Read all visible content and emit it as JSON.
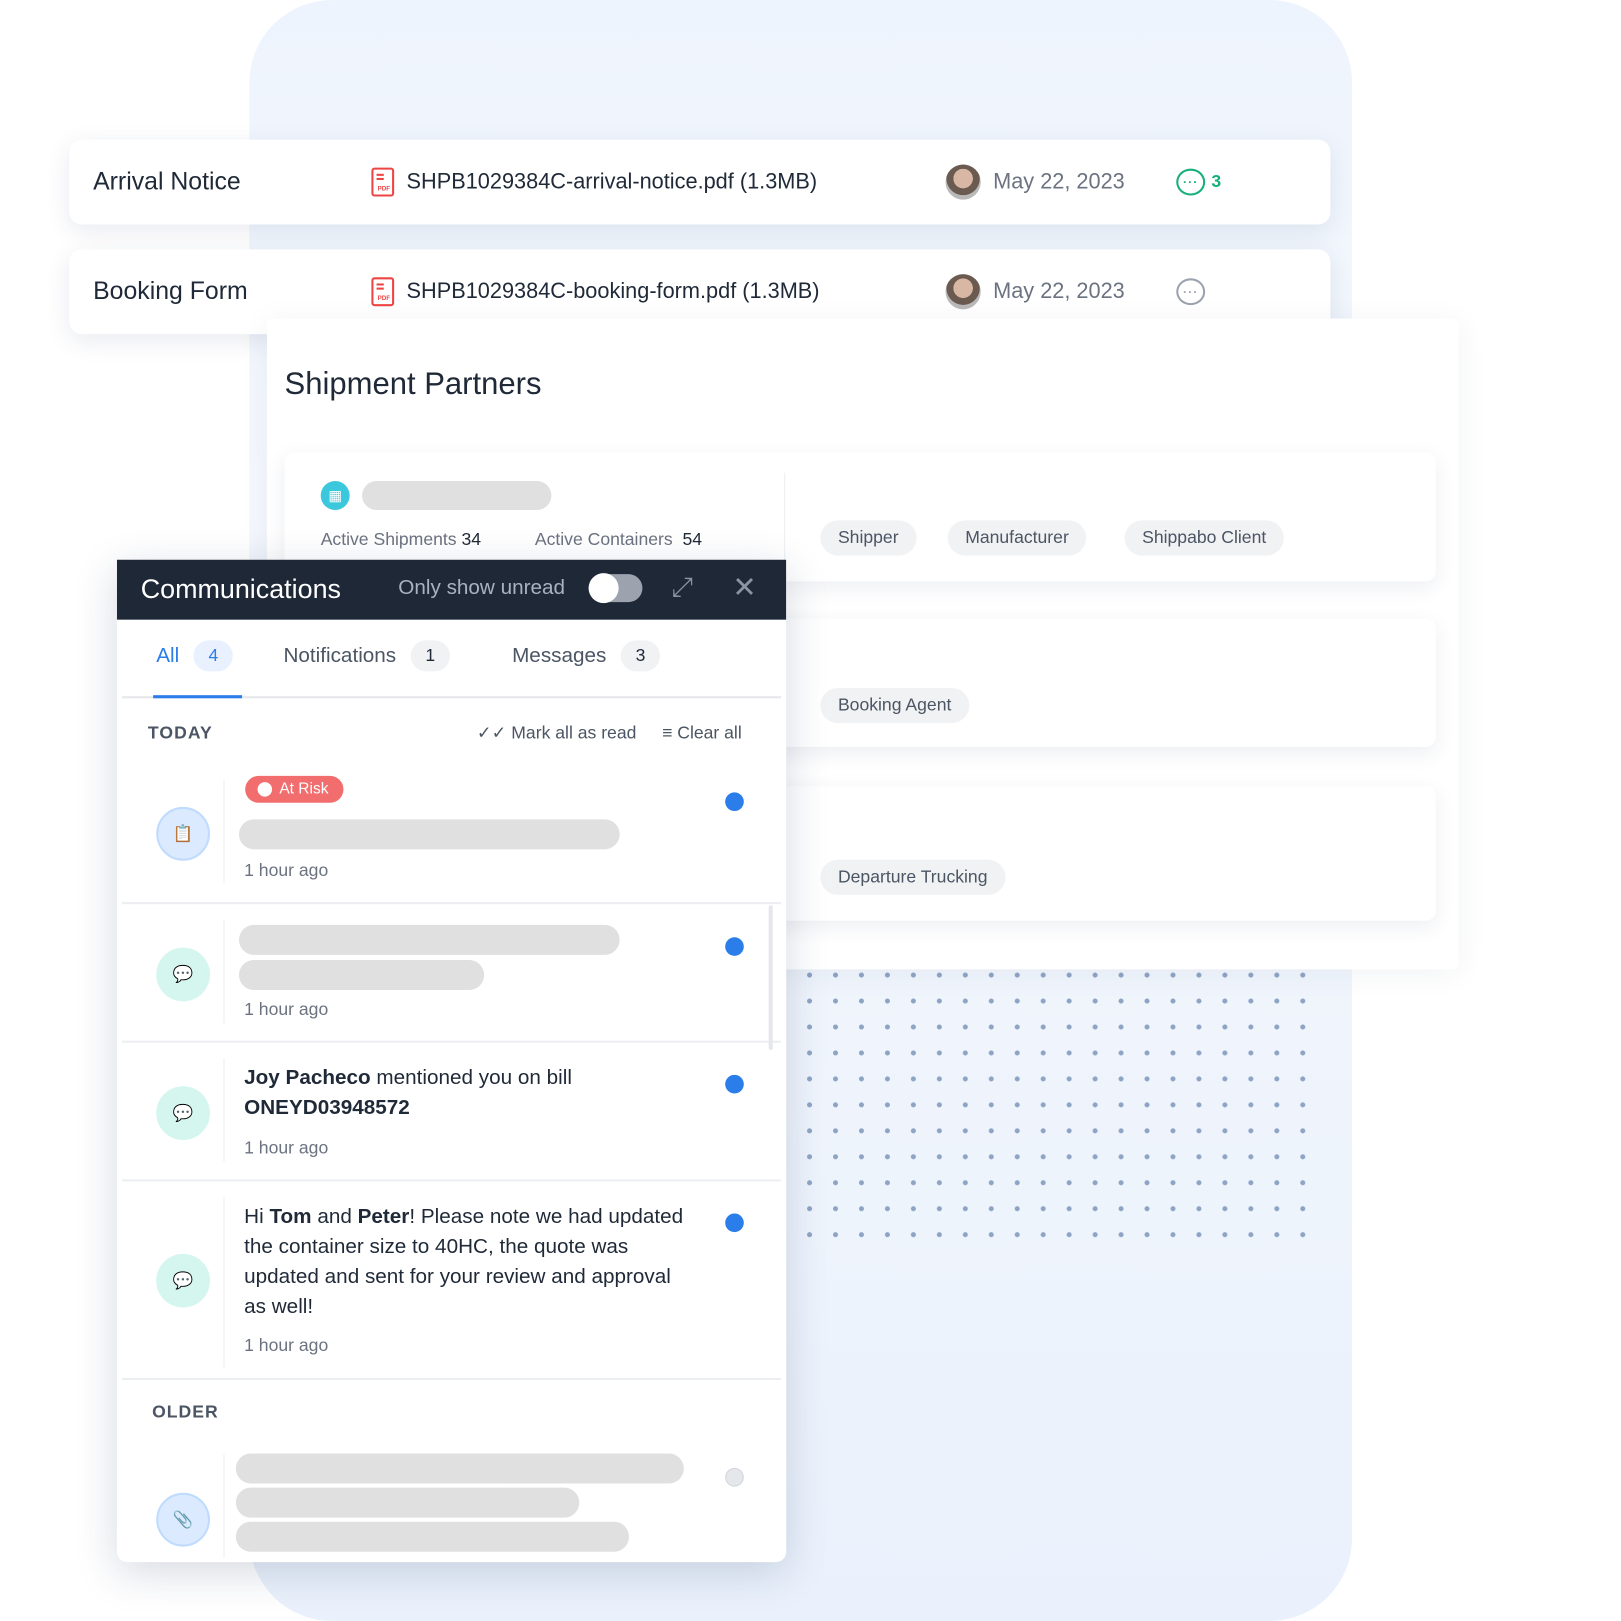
{
  "documents": [
    {
      "title": "Arrival Notice",
      "file": "SHPB1029384C-arrival-notice.pdf (1.3MB)",
      "date": "May 22, 2023",
      "comments": "3",
      "comment_color": "#16b07a"
    },
    {
      "title": "Booking Form",
      "file": "SHPB1029384C-booking-form.pdf (1.3MB)",
      "date": "May 22, 2023",
      "comments": "",
      "comment_color": "#9ca3af"
    }
  ],
  "pdf_label": "PDF",
  "partners": {
    "title": "Shipment Partners",
    "stats": {
      "shipments_label": "Active Shipments",
      "shipments": "34",
      "containers_label": "Active Containers",
      "containers": "54"
    },
    "rows": [
      [
        "Shipper",
        "Manufacturer",
        "Shippabo Client"
      ],
      [
        "Booking Agent"
      ],
      [
        "Departure Trucking"
      ]
    ]
  },
  "comm": {
    "title": "Communications",
    "unread_label": "Only show unread",
    "unread_on": false,
    "tabs": [
      {
        "label": "All",
        "count": "4"
      },
      {
        "label": "Notifications",
        "count": "1"
      },
      {
        "label": "Messages",
        "count": "3"
      }
    ],
    "today": "TODAY",
    "older": "OLDER",
    "mark_all": "Mark all as read",
    "clear_all": "Clear all",
    "at_risk": "At Risk",
    "time": "1 hour ago",
    "m3": {
      "name": "Joy Pacheco",
      "text": " mentioned you on bill ",
      "bill": "ONEYD03948572"
    },
    "m4": {
      "a": "Hi ",
      "b": "Tom",
      "c": " and ",
      "d": "Peter",
      "e": "! Please note we had updated the container size to 40HC, the quote was updated and sent for your review and approval as well!"
    },
    "accent": "#2b7de9"
  }
}
